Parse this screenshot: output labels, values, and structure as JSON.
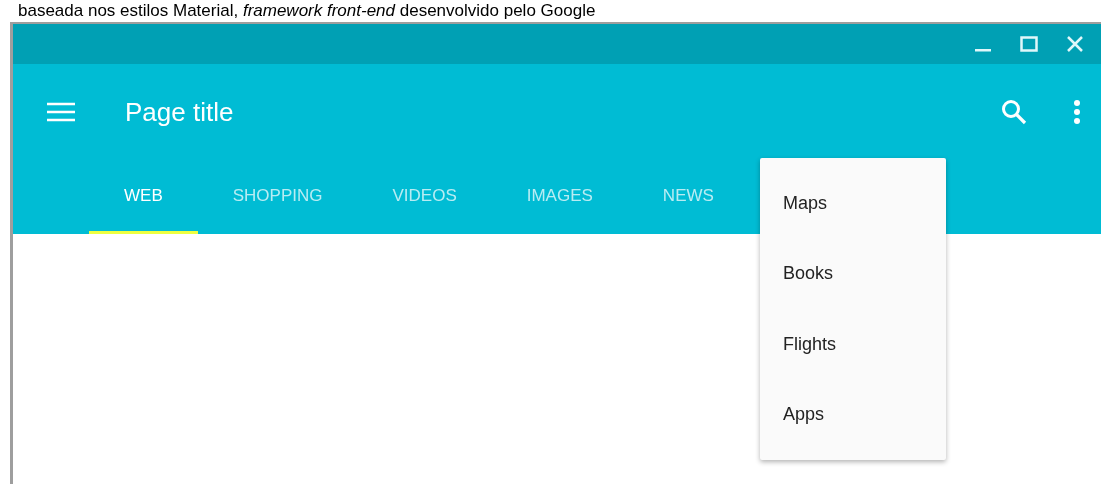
{
  "caption": "baseada nos estilos Material, *framework front-end* desenvolvido pelo Google",
  "window": {
    "title_bar_controls": [
      {
        "kind": "minimize"
      },
      {
        "kind": "maximize"
      },
      {
        "kind": "close"
      }
    ]
  },
  "toolbar": {
    "title": "Page title"
  },
  "tabs": [
    {
      "label": "WEB",
      "selected": true
    },
    {
      "label": "SHOPPING",
      "selected": false
    },
    {
      "label": "VIDEOS",
      "selected": false
    },
    {
      "label": "IMAGES",
      "selected": false
    },
    {
      "label": "NEWS",
      "selected": false
    }
  ],
  "menu": {
    "items": [
      "Maps",
      "Books",
      "Flights",
      "Apps"
    ]
  }
}
